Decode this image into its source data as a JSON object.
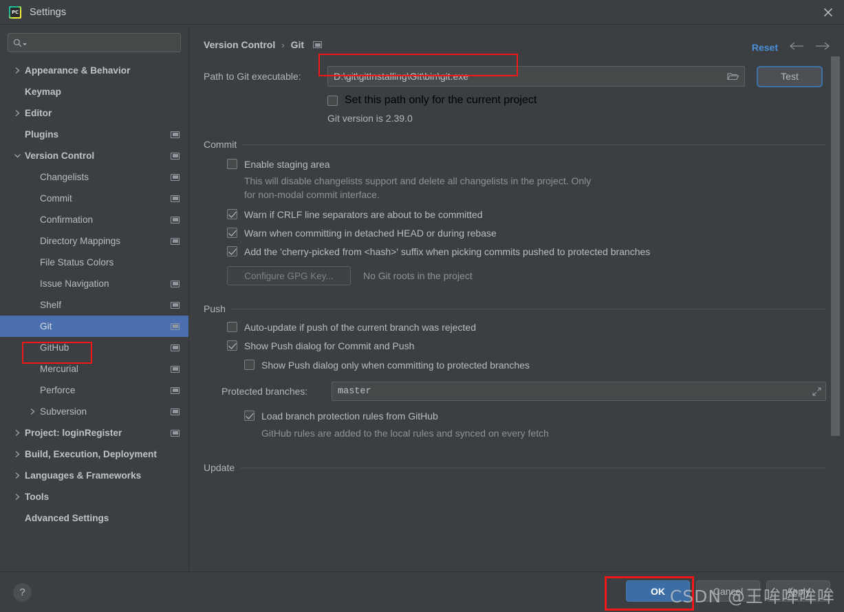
{
  "window": {
    "title": "Settings",
    "app_icon": "pycharm-icon",
    "close_icon": "close-icon"
  },
  "sidebar": {
    "search": {
      "placeholder": "",
      "value": "",
      "icon": "search-icon"
    },
    "items": [
      {
        "label": "Appearance & Behavior",
        "twisty": "collapsed",
        "bold": true,
        "indent": 1,
        "badge": false,
        "selected": false
      },
      {
        "label": "Keymap",
        "twisty": "none",
        "bold": true,
        "indent": 1,
        "badge": false,
        "selected": false
      },
      {
        "label": "Editor",
        "twisty": "collapsed",
        "bold": true,
        "indent": 1,
        "badge": false,
        "selected": false
      },
      {
        "label": "Plugins",
        "twisty": "none",
        "bold": true,
        "indent": 1,
        "badge": true,
        "selected": false
      },
      {
        "label": "Version Control",
        "twisty": "expanded",
        "bold": true,
        "indent": 1,
        "badge": true,
        "selected": false
      },
      {
        "label": "Changelists",
        "twisty": "none",
        "bold": false,
        "indent": 2,
        "badge": true,
        "selected": false
      },
      {
        "label": "Commit",
        "twisty": "none",
        "bold": false,
        "indent": 2,
        "badge": true,
        "selected": false
      },
      {
        "label": "Confirmation",
        "twisty": "none",
        "bold": false,
        "indent": 2,
        "badge": true,
        "selected": false
      },
      {
        "label": "Directory Mappings",
        "twisty": "none",
        "bold": false,
        "indent": 2,
        "badge": true,
        "selected": false
      },
      {
        "label": "File Status Colors",
        "twisty": "none",
        "bold": false,
        "indent": 2,
        "badge": false,
        "selected": false
      },
      {
        "label": "Issue Navigation",
        "twisty": "none",
        "bold": false,
        "indent": 2,
        "badge": true,
        "selected": false
      },
      {
        "label": "Shelf",
        "twisty": "none",
        "bold": false,
        "indent": 2,
        "badge": true,
        "selected": false
      },
      {
        "label": "Git",
        "twisty": "none",
        "bold": false,
        "indent": 2,
        "badge": true,
        "selected": true
      },
      {
        "label": "GitHub",
        "twisty": "none",
        "bold": false,
        "indent": 2,
        "badge": true,
        "selected": false
      },
      {
        "label": "Mercurial",
        "twisty": "none",
        "bold": false,
        "indent": 2,
        "badge": true,
        "selected": false
      },
      {
        "label": "Perforce",
        "twisty": "none",
        "bold": false,
        "indent": 2,
        "badge": true,
        "selected": false
      },
      {
        "label": "Subversion",
        "twisty": "collapsed",
        "bold": false,
        "indent": 2,
        "badge": true,
        "selected": false
      },
      {
        "label": "Project: loginRegister",
        "twisty": "collapsed",
        "bold": true,
        "indent": 1,
        "badge": true,
        "selected": false
      },
      {
        "label": "Build, Execution, Deployment",
        "twisty": "collapsed",
        "bold": true,
        "indent": 1,
        "badge": false,
        "selected": false
      },
      {
        "label": "Languages & Frameworks",
        "twisty": "collapsed",
        "bold": true,
        "indent": 1,
        "badge": false,
        "selected": false
      },
      {
        "label": "Tools",
        "twisty": "collapsed",
        "bold": true,
        "indent": 1,
        "badge": false,
        "selected": false
      },
      {
        "label": "Advanced Settings",
        "twisty": "none",
        "bold": true,
        "indent": 1,
        "badge": false,
        "selected": false
      }
    ]
  },
  "main": {
    "breadcrumb": {
      "parent": "Version Control",
      "separator": "›",
      "current": "Git"
    },
    "reset_label": "Reset",
    "back_icon": "arrow-left-icon",
    "forward_icon": "arrow-right-icon",
    "path": {
      "label": "Path to Git executable:",
      "value": "D:\\git\\gitInstalling\\Git\\bin\\git.exe",
      "placeholder": "",
      "browse_icon": "folder-icon",
      "test_label": "Test"
    },
    "path_only_project": {
      "label": "Set this path only for the current project",
      "checked": false
    },
    "git_version": "Git version is 2.39.0",
    "commit": {
      "title": "Commit",
      "staging": {
        "label": "Enable staging area",
        "checked": false,
        "description": "This will disable changelists support and delete all changelists in the project. Only for non-modal commit interface."
      },
      "options": [
        {
          "label": "Warn if CRLF line separators are about to be committed",
          "checked": true
        },
        {
          "label": "Warn when committing in detached HEAD or during rebase",
          "checked": true
        },
        {
          "label": "Add the 'cherry-picked from <hash>' suffix when picking commits pushed to protected branches",
          "checked": true
        }
      ],
      "gpg_button": "Configure GPG Key...",
      "gpg_note": "No Git roots in the project"
    },
    "push": {
      "title": "Push",
      "options": [
        {
          "label": "Auto-update if push of the current branch was rejected",
          "checked": false
        },
        {
          "label": "Show Push dialog for Commit and Push",
          "checked": true
        }
      ],
      "sub_option": {
        "label": "Show Push dialog only when committing to protected branches",
        "checked": false
      },
      "protected_branches": {
        "label": "Protected branches:",
        "value": "master",
        "expand_icon": "expand-icon"
      },
      "load_rules": {
        "label": "Load branch protection rules from GitHub",
        "checked": true,
        "description": "GitHub rules are added to the local rules and synced on every fetch"
      }
    },
    "update": {
      "title": "Update"
    }
  },
  "footer": {
    "help_label": "?",
    "ok_label": "OK",
    "cancel_label": "Cancel",
    "apply_label": "Apply"
  },
  "watermark": "CSDN @王哞哞哞哞",
  "colors": {
    "background": "#3c3f41",
    "selection": "#4b6eaf",
    "accent_link": "#4a90d9",
    "primary_button": "#3c6da5",
    "annotation": "#f41717"
  }
}
